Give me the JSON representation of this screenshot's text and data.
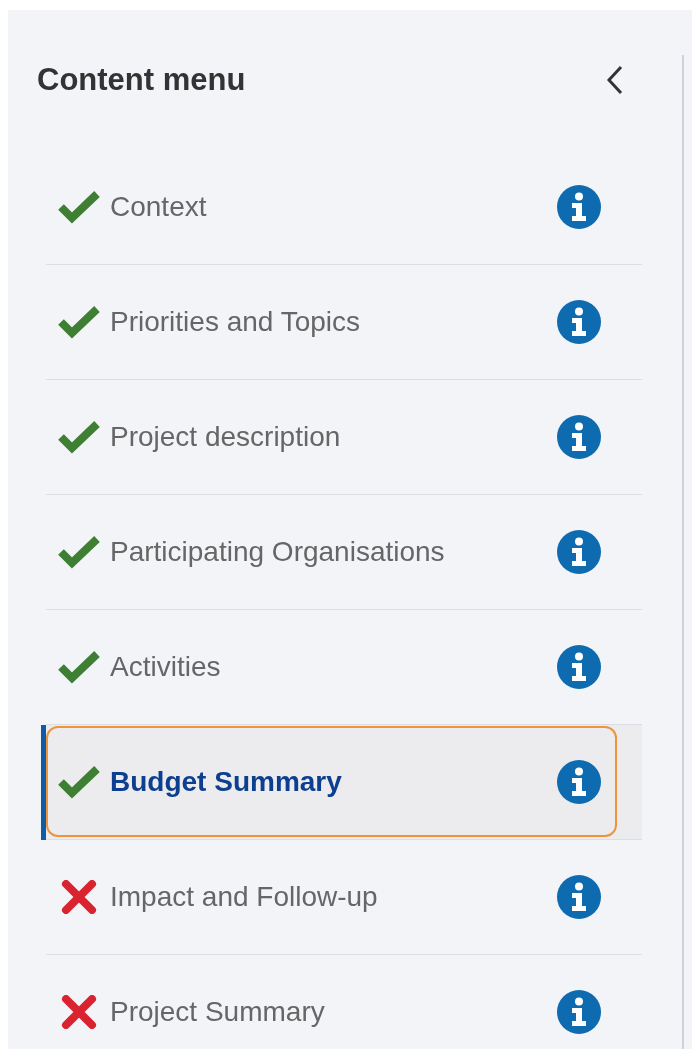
{
  "panel": {
    "title": "Content menu"
  },
  "items": [
    {
      "label": "Context",
      "done": true,
      "selected": false
    },
    {
      "label": "Priorities and Topics",
      "done": true,
      "selected": false
    },
    {
      "label": "Project description",
      "done": true,
      "selected": false
    },
    {
      "label": "Participating Organisations",
      "done": true,
      "selected": false
    },
    {
      "label": "Activities",
      "done": true,
      "selected": false
    },
    {
      "label": "Budget Summary",
      "done": true,
      "selected": true
    },
    {
      "label": "Impact and Follow-up",
      "done": false,
      "selected": false
    },
    {
      "label": "Project Summary",
      "done": false,
      "selected": false
    }
  ]
}
